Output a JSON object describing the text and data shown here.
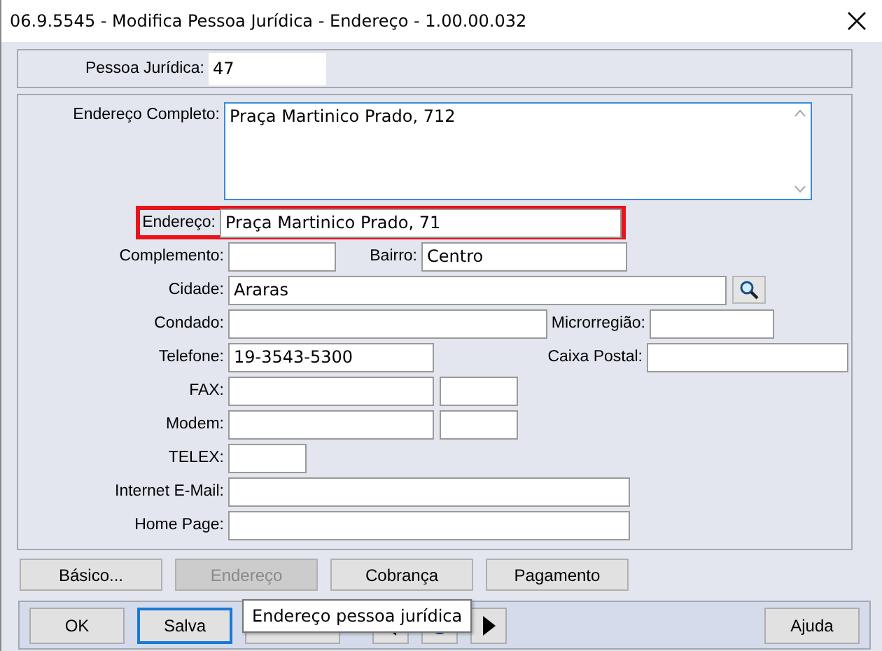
{
  "window": {
    "title": "06.9.5545 - Modifica Pessoa Jurídica - Endereço - 1.00.00.032"
  },
  "header": {
    "label": "Pessoa Jurídica:",
    "value": "47"
  },
  "address_full": {
    "label": "Endereço Completo:",
    "value": "Praça Martinico Prado, 712"
  },
  "rows": [
    {
      "highlighted": true,
      "fields": [
        {
          "kind": "text",
          "label": "Endereço:",
          "value": "Praça Martinico Prado, 71"
        }
      ]
    },
    {
      "highlighted": false,
      "fields": [
        {
          "kind": "text",
          "label": "Complemento:"
        },
        {
          "kind": "text",
          "label": "Bairro:",
          "value": "Centro"
        }
      ]
    },
    {
      "highlighted": false,
      "fields": [
        {
          "kind": "lookup",
          "label": "Cidade:",
          "value": "Araras"
        }
      ]
    },
    {
      "highlighted": false,
      "fields": [
        {
          "kind": "text",
          "label": "Condado:"
        },
        {
          "kind": "text",
          "label": "Microrregião:"
        }
      ]
    },
    {
      "highlighted": false,
      "fields": [
        {
          "kind": "text",
          "label": "Telefone:",
          "value": "19-3543-5300"
        },
        {
          "kind": "text",
          "label": "Caixa Postal:"
        }
      ]
    },
    {
      "highlighted": false,
      "fields": [
        {
          "kind": "text",
          "label": "FAX:"
        },
        {
          "kind": "text"
        }
      ]
    },
    {
      "highlighted": false,
      "fields": [
        {
          "kind": "text",
          "label": "Modem:"
        },
        {
          "kind": "text"
        }
      ]
    },
    {
      "highlighted": false,
      "fields": [
        {
          "kind": "text",
          "label": "TELEX:"
        }
      ]
    },
    {
      "highlighted": false,
      "fields": [
        {
          "kind": "text",
          "label": "Internet E-Mail:"
        }
      ]
    },
    {
      "highlighted": false,
      "fields": [
        {
          "kind": "text",
          "label": "Home Page:"
        }
      ]
    }
  ],
  "tabs": [
    {
      "label": "Básico...",
      "disabled": false
    },
    {
      "label": "Endereço",
      "disabled": true
    },
    {
      "label": "Cobrança",
      "disabled": false
    },
    {
      "label": "Pagamento",
      "disabled": false
    }
  ],
  "footer_buttons": [
    {
      "kind": "text",
      "label": "OK",
      "focused": false
    },
    {
      "kind": "text",
      "label": "Salva",
      "focused": true
    },
    {
      "kind": "text",
      "focused": false
    },
    {
      "kind": "prev",
      "focused": false
    },
    {
      "kind": "refresh",
      "focused": false
    },
    {
      "kind": "next",
      "focused": false
    },
    {
      "kind": "text",
      "label": "Ajuda",
      "focused": false
    }
  ],
  "tooltip": {
    "text": "Endereço pessoa jurídica"
  }
}
